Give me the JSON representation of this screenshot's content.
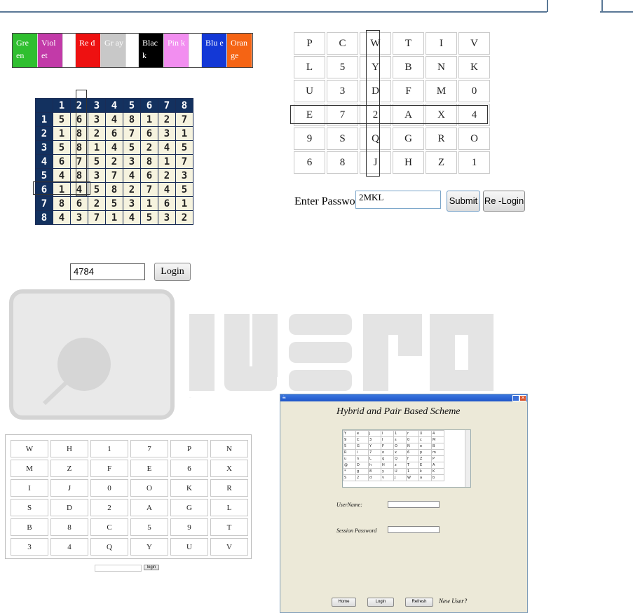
{
  "color_swatches": [
    {
      "label": "Gre en",
      "color": "#2fbf2f"
    },
    {
      "label": "Viol et",
      "color": "#c23aa8"
    },
    {
      "label": "",
      "color": "#ffffff"
    },
    {
      "label": "Re d",
      "color": "#ee1111"
    },
    {
      "label": "Gr ay",
      "color": "#c8c8c8"
    },
    {
      "label": "",
      "color": "#ffffff"
    },
    {
      "label": "Blac k",
      "color": "#000000"
    },
    {
      "label": "Pin k",
      "color": "#f28ef0"
    },
    {
      "label": "",
      "color": "#ffffff"
    },
    {
      "label": "Blu e",
      "color": "#1338d6"
    },
    {
      "label": "Oran ge",
      "color": "#f56414"
    }
  ],
  "number_grid": {
    "header": [
      "1",
      "2",
      "3",
      "4",
      "5",
      "6",
      "7",
      "8"
    ],
    "rows": [
      [
        "5",
        "6",
        "3",
        "4",
        "8",
        "1",
        "2",
        "7"
      ],
      [
        "1",
        "8",
        "2",
        "6",
        "7",
        "6",
        "3",
        "1"
      ],
      [
        "5",
        "8",
        "1",
        "4",
        "5",
        "2",
        "4",
        "5"
      ],
      [
        "6",
        "7",
        "5",
        "2",
        "3",
        "8",
        "1",
        "7"
      ],
      [
        "4",
        "8",
        "3",
        "7",
        "4",
        "6",
        "2",
        "3"
      ],
      [
        "1",
        "4",
        "5",
        "8",
        "2",
        "7",
        "4",
        "5"
      ],
      [
        "8",
        "6",
        "2",
        "5",
        "3",
        "1",
        "6",
        "1"
      ],
      [
        "4",
        "3",
        "7",
        "1",
        "4",
        "5",
        "3",
        "2"
      ]
    ]
  },
  "letter_grid": [
    [
      "P",
      "C",
      "W",
      "T",
      "I",
      "V"
    ],
    [
      "L",
      "5",
      "Y",
      "B",
      "N",
      "K"
    ],
    [
      "U",
      "3",
      "D",
      "F",
      "M",
      "0"
    ],
    [
      "E",
      "7",
      "2",
      "A",
      "X",
      "4"
    ],
    [
      "9",
      "S",
      "Q",
      "G",
      "R",
      "O"
    ],
    [
      "6",
      "8",
      "J",
      "H",
      "Z",
      "1"
    ]
  ],
  "password_form": {
    "label": "Enter Password :",
    "value": "2MKL",
    "submit_label": "Submit",
    "relogin_label": "Re -Login"
  },
  "pin_form": {
    "value": "4784",
    "login_label": "Login"
  },
  "watermark_text": "IJSRD",
  "bottom_grid": [
    [
      "W",
      "H",
      "1",
      "7",
      "P",
      "N"
    ],
    [
      "M",
      "Z",
      "F",
      "E",
      "6",
      "X"
    ],
    [
      "I",
      "J",
      "0",
      "O",
      "K",
      "R"
    ],
    [
      "S",
      "D",
      "2",
      "A",
      "G",
      "L"
    ],
    [
      "B",
      "8",
      "C",
      "5",
      "9",
      "T"
    ],
    [
      "3",
      "4",
      "Q",
      "Y",
      "U",
      "V"
    ]
  ],
  "bottom_login_label": "login",
  "app_window": {
    "heading": "Hybrid and Pair Based Scheme",
    "grid": [
      [
        "Y",
        "e",
        "j",
        "l",
        "1",
        "r",
        "X",
        "4"
      ],
      [
        "9",
        "C",
        "3",
        "I",
        "s",
        "0",
        "c",
        "M"
      ],
      [
        "5",
        "G",
        "Y",
        "F",
        "O",
        "N",
        "e",
        "B"
      ],
      [
        "R",
        "i",
        "7",
        "o",
        "x",
        "6",
        "p",
        "m"
      ],
      [
        "u",
        "n",
        "L",
        "q",
        "Q",
        "f",
        "Z",
        "P"
      ],
      [
        "@",
        "D",
        "h",
        "H",
        "z",
        "T",
        "E",
        "A"
      ],
      [
        "*",
        "g",
        "8",
        "y",
        "U",
        "1",
        "k",
        "K"
      ],
      [
        "S",
        "2",
        "d",
        "v",
        "J",
        "W",
        "a",
        "b"
      ]
    ],
    "username_label": "UserName:",
    "session_label": "Session Password",
    "home_label": "Home",
    "login_label": "Login",
    "refresh_label": "Refresh",
    "new_user_label": "New User?"
  }
}
